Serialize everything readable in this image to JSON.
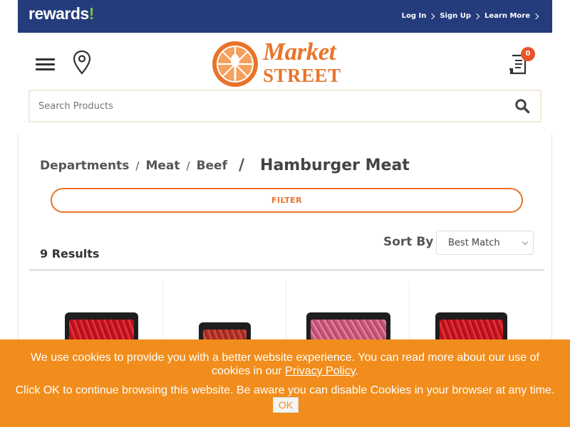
{
  "rewards": {
    "logo_text": "rewards",
    "logo_bang": "!",
    "links": [
      {
        "label": "Log In"
      },
      {
        "label": "Sign Up"
      },
      {
        "label": "Learn More"
      }
    ]
  },
  "header": {
    "logo_line1": "Market",
    "logo_line2": "STREET",
    "list_count": "0",
    "icons": {
      "menu": "hamburger-icon",
      "location": "location-pin-icon",
      "list": "shopping-list-icon",
      "search": "search-icon"
    }
  },
  "search": {
    "placeholder": "Search Products",
    "value": ""
  },
  "breadcrumb": {
    "items": [
      "Departments",
      "Meat",
      "Beef"
    ],
    "separator": "/",
    "current": "Hamburger Meat"
  },
  "filter": {
    "label": "FILTER"
  },
  "results": {
    "text": "9 Results"
  },
  "sort": {
    "label": "Sort By",
    "selected": "Best Match"
  },
  "products": [
    {
      "name": "ground beef tray 1"
    },
    {
      "name": "ground beef tray 2"
    },
    {
      "name": "ground beef tray 3"
    },
    {
      "name": "ground beef tray 4"
    }
  ],
  "cookie": {
    "text1": "We use cookies to provide you with a better website experience. You can read more about our use of cookies in our ",
    "link": "Privacy Policy",
    "text1_end": ".",
    "text2": "Click OK to continue browsing this website. Be aware you can disable Cookies in your browser at any time.",
    "ok": "OK"
  },
  "colors": {
    "navy": "#243c7c",
    "orange": "#e8742a",
    "banner": "#f18d1c",
    "rewards_green": "#7bc043"
  }
}
